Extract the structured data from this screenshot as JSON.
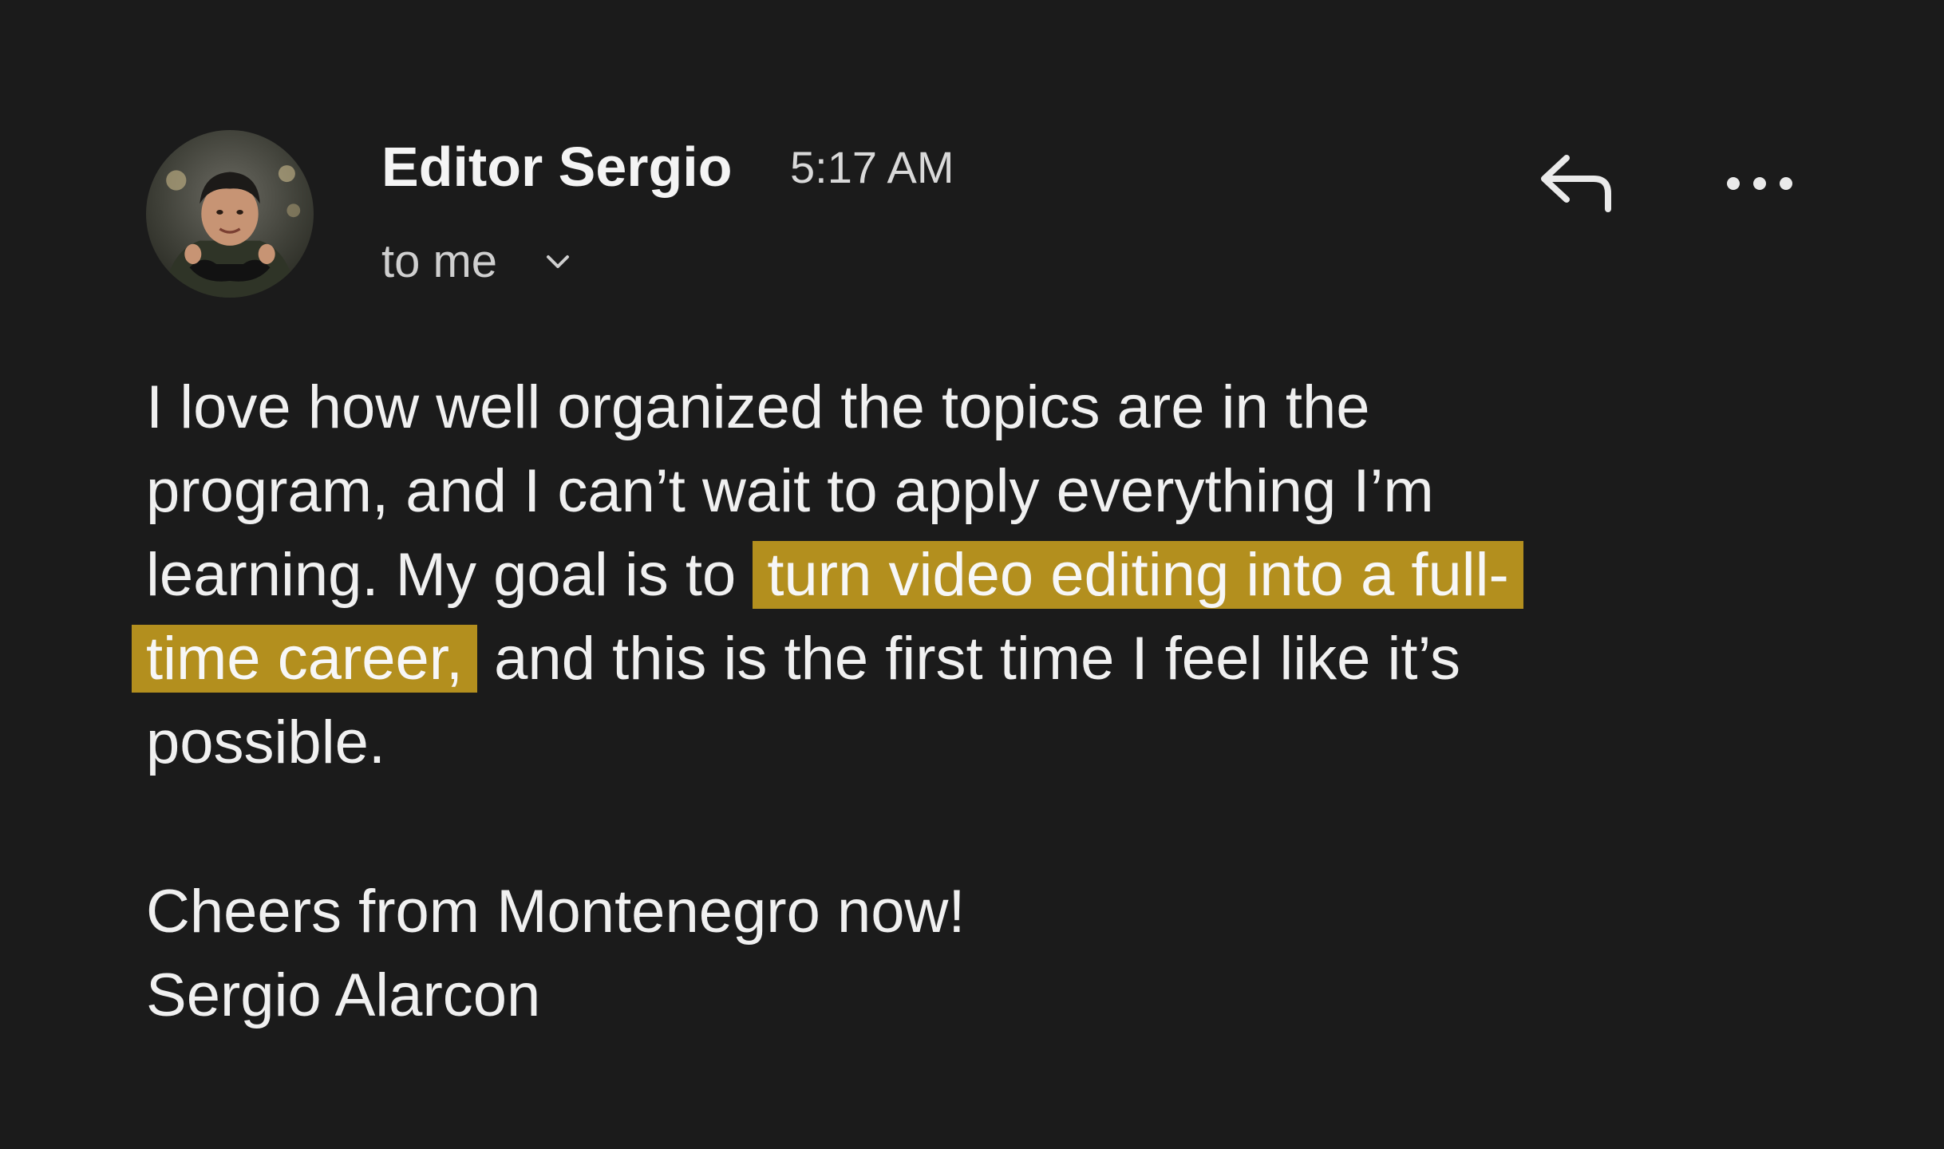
{
  "sender": {
    "name": "Editor Sergio",
    "time": "5:17 AM",
    "recipient_label": "to me"
  },
  "icons": {
    "avatar": "profile-photo",
    "recipient_toggle": "chevron-down-icon",
    "reply": "reply-icon",
    "more": "more-horizontal-icon"
  },
  "colors": {
    "background": "#1b1b1b",
    "highlight": "#b38f1e",
    "text": "#f0f0f0"
  },
  "message": {
    "lines": [
      "I love how well organized the topics are in the",
      "program, and I can’t wait to apply everything I’m",
      "learning. My goal is to "
    ],
    "highlight_line1": "turn video editing into a full-",
    "highlight_line2": "time career,",
    "line4_tail": " and this is the first time I feel like it’s",
    "line5": "possible.",
    "signoff_line1": "Cheers from Montenegro now!",
    "signoff_line2": "Sergio Alarcon"
  }
}
